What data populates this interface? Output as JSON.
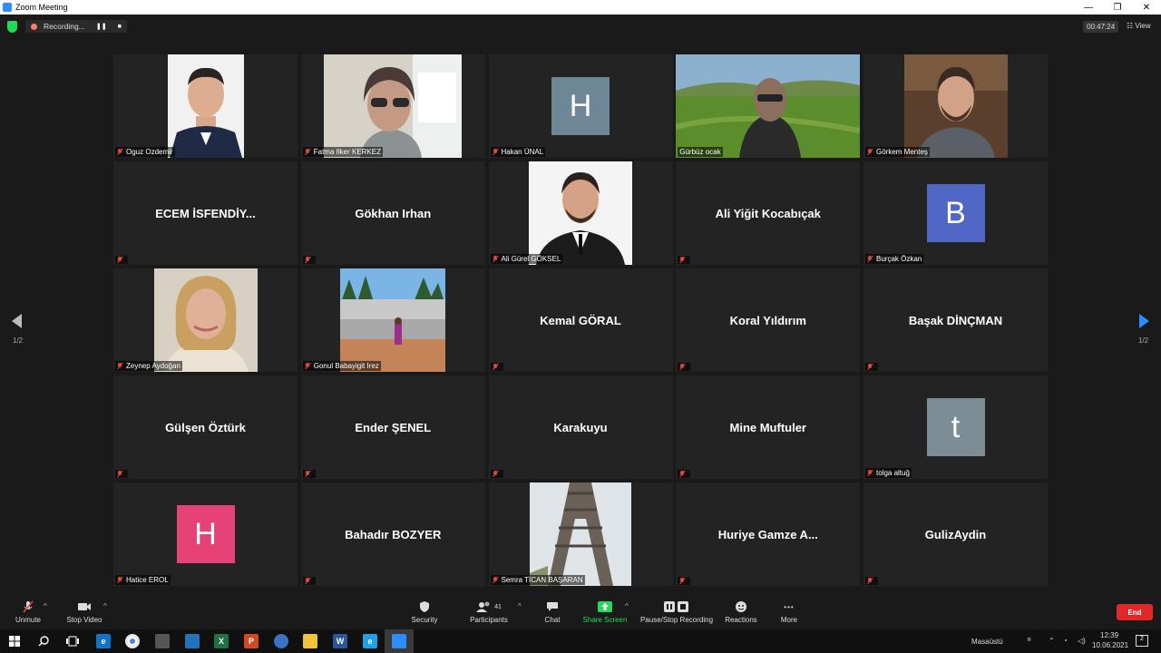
{
  "window": {
    "title": "Zoom Meeting",
    "min_glyph": "—",
    "max_glyph": "❐",
    "close_glyph": "✕"
  },
  "topbar": {
    "recording_label": "Recording...",
    "pause_glyph": "❚❚",
    "stop_glyph": "■",
    "timer": "00:47:24",
    "view_label": "View",
    "view_glyph": "☷"
  },
  "gallery": {
    "page_indicator": "1/2",
    "tiles": [
      {
        "label": "Oguz Ozdemir",
        "kind": "photo"
      },
      {
        "label": "Fatma  Ilker KERKEZ",
        "kind": "photo"
      },
      {
        "label": "Hakan ÜNAL",
        "kind": "avatar",
        "letter": "H",
        "color": "#6d8796"
      },
      {
        "label": "Gürbüz ocak",
        "kind": "photo",
        "active": true
      },
      {
        "label": "Görkem Menteş",
        "kind": "photo"
      },
      {
        "label": "ECEM  İSFENDİY...",
        "kind": "name"
      },
      {
        "label": "Gökhan Irhan",
        "kind": "name"
      },
      {
        "label": "Ali Gürel GÖKSEL",
        "kind": "photo"
      },
      {
        "label": "Ali Yiğit Kocabıçak",
        "kind": "name"
      },
      {
        "label": "Burçak Özkan",
        "kind": "avatar",
        "letter": "B",
        "color": "#5067c6"
      },
      {
        "label": "Zeynep Aydoğan",
        "kind": "photo"
      },
      {
        "label": "Gonul Babayigit Irez",
        "kind": "photo"
      },
      {
        "label": "Kemal GÖRAL",
        "kind": "name"
      },
      {
        "label": "Koral Yıldırım",
        "kind": "name"
      },
      {
        "label": "Başak DİNÇMAN",
        "kind": "name"
      },
      {
        "label": "Gülşen Öztürk",
        "kind": "name"
      },
      {
        "label": "Ender ŞENEL",
        "kind": "name"
      },
      {
        "label": "Karakuyu",
        "kind": "name"
      },
      {
        "label": "Mine Muftuler",
        "kind": "name"
      },
      {
        "label": "tolga altuğ",
        "kind": "avatar",
        "letter": "t",
        "color": "#7d8d95"
      },
      {
        "label": "Hatice EROL",
        "kind": "avatar",
        "letter": "H",
        "color": "#e74277"
      },
      {
        "label": "Bahadır BOZYER",
        "kind": "name"
      },
      {
        "label": "Semra TİCAN BAŞARAN",
        "kind": "photo"
      },
      {
        "label": "Huriye Gamze A...",
        "kind": "name"
      },
      {
        "label": "GulizAydin",
        "kind": "name"
      }
    ]
  },
  "toolbar": {
    "unmute": "Unmute",
    "stop_video": "Stop Video",
    "security": "Security",
    "participants": "Participants",
    "participants_count": "41",
    "chat": "Chat",
    "share_screen": "Share Screen",
    "pause_recording": "Pause/Stop Recording",
    "reactions": "Reactions",
    "more": "More",
    "caret": "^",
    "more_glyph": "•••",
    "end": "End"
  },
  "taskbar": {
    "desktop": "Masaüstü",
    "time": "12:39",
    "date": "10.06.2021",
    "notif_count": "2"
  },
  "colors": {
    "active_border": "#c8e065",
    "share_green": "#23d959",
    "end_red": "#e02828",
    "accent_blue": "#2d8cff"
  }
}
